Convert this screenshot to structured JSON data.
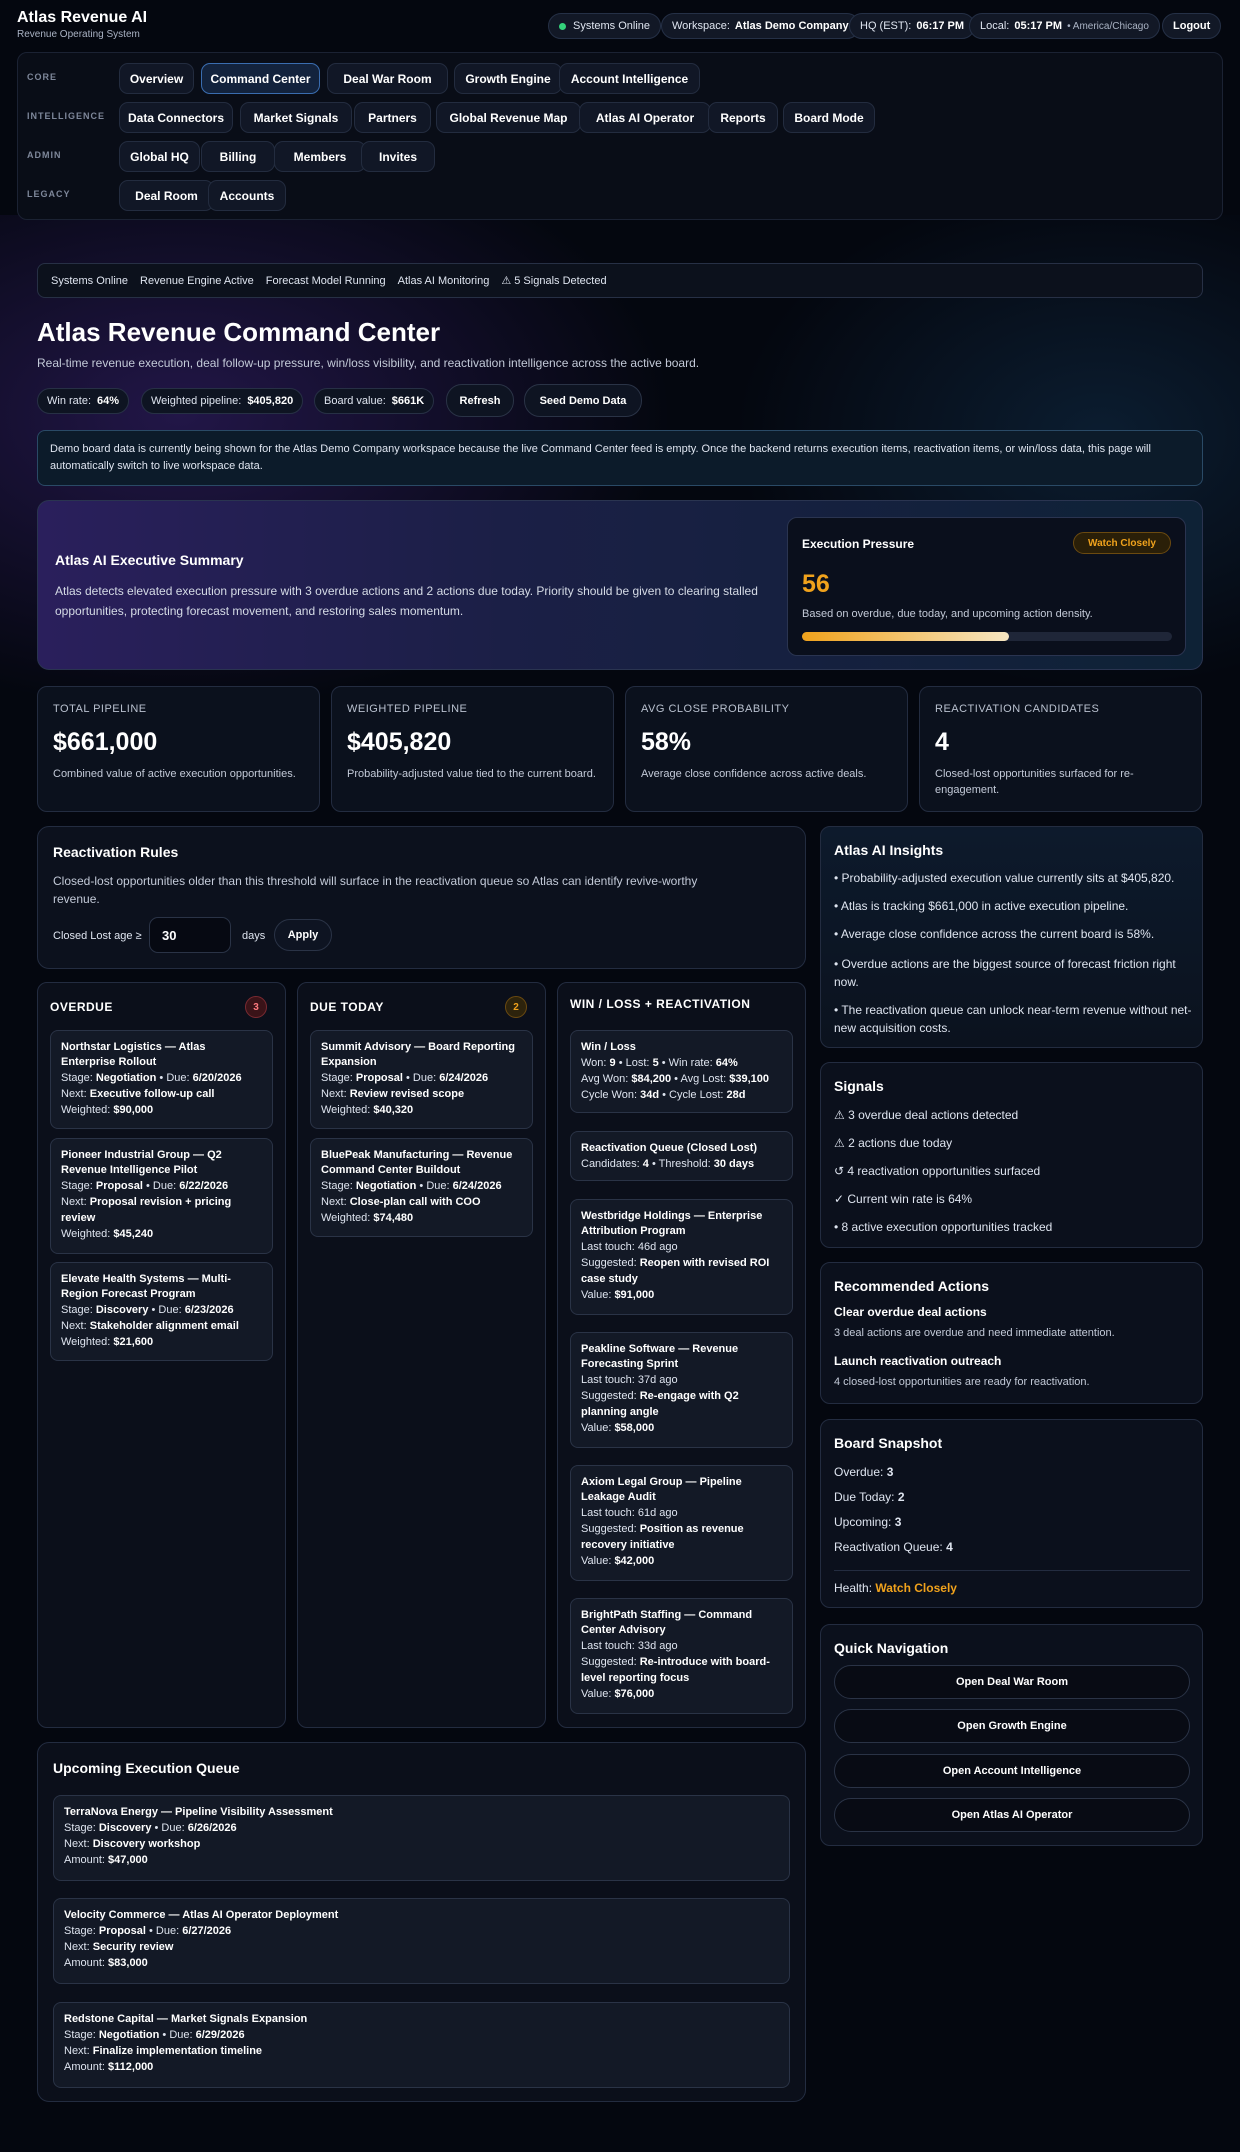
{
  "app": {
    "title": "Atlas Revenue AI",
    "subtitle": "Revenue Operating System"
  },
  "header": {
    "status": "Systems Online",
    "workspace_label": "Workspace:",
    "workspace": "Atlas Demo Company",
    "hq_label": "HQ (EST):",
    "hq_time": "06:17 PM",
    "local_label": "Local:",
    "local_time": "05:17 PM",
    "local_tz": "• America/Chicago",
    "logout": "Logout"
  },
  "nav": {
    "core_label": "CORE",
    "core": [
      "Overview",
      "Command Center",
      "Deal War Room",
      "Growth Engine",
      "Account Intelligence"
    ],
    "intel_label": "INTELLIGENCE",
    "intel": [
      "Data Connectors",
      "Market Signals",
      "Partners",
      "Global Revenue Map",
      "Atlas AI Operator",
      "Reports",
      "Board Mode"
    ],
    "admin_label": "ADMIN",
    "admin": [
      "Global HQ",
      "Billing",
      "Members",
      "Invites"
    ],
    "legacy_label": "LEGACY",
    "legacy": [
      "Deal Room",
      "Accounts"
    ]
  },
  "statusbar": [
    "Systems Online",
    "Revenue Engine Active",
    "Forecast Model Running",
    "Atlas AI Monitoring",
    "⚠ 5 Signals Detected"
  ],
  "page": {
    "title": "Atlas Revenue Command Center",
    "subtitle": "Real-time revenue execution, deal follow-up pressure, win/loss visibility, and reactivation intelligence across the active board.",
    "win_rate_label": "Win rate:",
    "win_rate": "64%",
    "weighted_label": "Weighted pipeline:",
    "weighted": "$405,820",
    "board_label": "Board value:",
    "board": "$661K",
    "refresh": "Refresh",
    "seed": "Seed Demo Data",
    "notice": "Demo board data is currently being shown for the Atlas Demo Company workspace because the live Command Center feed is empty. Once the backend returns execution items, reactivation items, or win/loss data, this page will automatically switch to live workspace data."
  },
  "summary": {
    "title": "Atlas AI Executive Summary",
    "text": "Atlas detects elevated execution pressure with 3 overdue actions and 2 actions due today. Priority should be given to clearing stalled opportunities, protecting forecast movement, and restoring sales momentum.",
    "pressure_title": "Execution Pressure",
    "pressure_badge": "Watch Closely",
    "pressure_value": "56",
    "pressure_fraction": 0.56,
    "pressure_desc": "Based on overdue, due today, and upcoming action density."
  },
  "metrics": [
    {
      "label": "TOTAL PIPELINE",
      "value": "$661,000",
      "desc": "Combined value of active execution opportunities."
    },
    {
      "label": "WEIGHTED PIPELINE",
      "value": "$405,820",
      "desc": "Probability-adjusted value tied to the current board."
    },
    {
      "label": "AVG CLOSE PROBABILITY",
      "value": "58%",
      "desc": "Average close confidence across active deals."
    },
    {
      "label": "REACTIVATION CANDIDATES",
      "value": "4",
      "desc": "Closed-lost opportunities surfaced for re-engagement."
    }
  ],
  "rules": {
    "title": "Reactivation Rules",
    "desc": "Closed-lost opportunities older than this threshold will surface in the reactivation queue so Atlas can identify revive-worthy revenue.",
    "input_label": "Closed Lost age ≥",
    "input_value": "30",
    "unit": "days",
    "apply": "Apply"
  },
  "overdue": {
    "title": "OVERDUE",
    "count": "3",
    "items": [
      {
        "name": "Northstar Logistics — Atlas Enterprise Rollout",
        "stage": "Negotiation",
        "due": "6/20/2026",
        "next": "Executive follow-up call",
        "weighted": "$90,000"
      },
      {
        "name": "Pioneer Industrial Group — Q2 Revenue Intelligence Pilot",
        "stage": "Proposal",
        "due": "6/22/2026",
        "next": "Proposal revision + pricing review",
        "weighted": "$45,240"
      },
      {
        "name": "Elevate Health Systems — Multi-Region Forecast Program",
        "stage": "Discovery",
        "due": "6/23/2026",
        "next": "Stakeholder alignment email",
        "weighted": "$21,600"
      }
    ]
  },
  "due_today": {
    "title": "DUE TODAY",
    "count": "2",
    "items": [
      {
        "name": "Summit Advisory — Board Reporting Expansion",
        "stage": "Proposal",
        "due": "6/24/2026",
        "next": "Review revised scope",
        "weighted": "$40,320"
      },
      {
        "name": "BluePeak Manufacturing — Revenue Command Center Buildout",
        "stage": "Negotiation",
        "due": "6/24/2026",
        "next": "Close-plan call with COO",
        "weighted": "$74,480"
      }
    ]
  },
  "winloss": {
    "title": "WIN / LOSS + REACTIVATION",
    "wl_title": "Win / Loss",
    "won_label": "Won:",
    "won": "9",
    "lost_label": "Lost:",
    "lost": "5",
    "rate_label": "Win rate:",
    "rate": "64%",
    "avg_won_label": "Avg Won:",
    "avg_won": "$84,200",
    "avg_lost_label": "Avg Lost:",
    "avg_lost": "$39,100",
    "cyc_won_label": "Cycle Won:",
    "cyc_won": "34d",
    "cyc_lost_label": "Cycle Lost:",
    "cyc_lost": "28d",
    "rq_title": "Reactivation Queue (Closed Lost)",
    "cand_label": "Candidates:",
    "cand": "4",
    "thr_label": "Threshold:",
    "thr": "30 days",
    "items": [
      {
        "name": "Westbridge Holdings — Enterprise Attribution Program",
        "touch": "46d ago",
        "suggested": "Reopen with revised ROI case study",
        "value": "$91,000"
      },
      {
        "name": "Peakline Software — Revenue Forecasting Sprint",
        "touch": "37d ago",
        "suggested": "Re-engage with Q2 planning angle",
        "value": "$58,000"
      },
      {
        "name": "Axiom Legal Group — Pipeline Leakage Audit",
        "touch": "61d ago",
        "suggested": "Position as revenue recovery initiative",
        "value": "$42,000"
      },
      {
        "name": "BrightPath Staffing — Command Center Advisory",
        "touch": "33d ago",
        "suggested": "Re-introduce with board-level reporting focus",
        "value": "$76,000"
      }
    ]
  },
  "upcoming": {
    "title": "Upcoming Execution Queue",
    "items": [
      {
        "name": "TerraNova Energy — Pipeline Visibility Assessment",
        "stage": "Discovery",
        "due": "6/26/2026",
        "next": "Discovery workshop",
        "amount": "$47,000"
      },
      {
        "name": "Velocity Commerce — Atlas AI Operator Deployment",
        "stage": "Proposal",
        "due": "6/27/2026",
        "next": "Security review",
        "amount": "$83,000"
      },
      {
        "name": "Redstone Capital — Market Signals Expansion",
        "stage": "Negotiation",
        "due": "6/29/2026",
        "next": "Finalize implementation timeline",
        "amount": "$112,000"
      }
    ]
  },
  "insights": {
    "title": "Atlas AI Insights",
    "items": [
      "• Probability-adjusted execution value currently sits at $405,820.",
      "• Atlas is tracking $661,000 in active execution pipeline.",
      "• Average close confidence across the current board is 58%.",
      "• Overdue actions are the biggest source of forecast friction right now.",
      "• The reactivation queue can unlock near-term revenue without net-new acquisition costs."
    ]
  },
  "signals": {
    "title": "Signals",
    "items": [
      "⚠ 3 overdue deal actions detected",
      "⚠ 2 actions due today",
      "↺ 4 reactivation opportunities surfaced",
      "✓ Current win rate is 64%",
      "• 8 active execution opportunities tracked"
    ]
  },
  "recommended": {
    "title": "Recommended Actions",
    "items": [
      {
        "title": "Clear overdue deal actions",
        "desc": "3 deal actions are overdue and need immediate attention."
      },
      {
        "title": "Launch reactivation outreach",
        "desc": "4 closed-lost opportunities are ready for reactivation."
      }
    ]
  },
  "snapshot": {
    "title": "Board Snapshot",
    "overdue_label": "Overdue:",
    "overdue": "3",
    "due_label": "Due Today:",
    "due": "2",
    "upcoming_label": "Upcoming:",
    "upcoming": "3",
    "react_label": "Reactivation Queue:",
    "react": "4",
    "health_label": "Health:",
    "health": "Watch Closely"
  },
  "quicknav": {
    "title": "Quick Navigation",
    "items": [
      "Open Deal War Room",
      "Open Growth Engine",
      "Open Account Intelligence",
      "Open Atlas AI Operator"
    ]
  },
  "colors": {
    "accent": "#3a6db0",
    "warn": "#f0a21c",
    "danger": "#e5484d",
    "success": "#34d27b"
  }
}
